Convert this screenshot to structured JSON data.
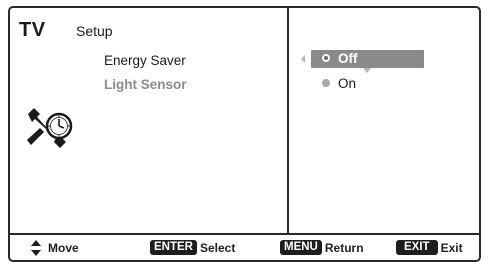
{
  "header": {
    "brand": "TV",
    "section": "Setup"
  },
  "menu": {
    "items": [
      {
        "label": "Energy Saver",
        "state": "active"
      },
      {
        "label": "Light Sensor",
        "state": "disabled"
      }
    ]
  },
  "options": {
    "items": [
      {
        "label": "Off",
        "selected": true
      },
      {
        "label": "On",
        "selected": false
      }
    ]
  },
  "icons": {
    "tools": "wrench-clock-icon",
    "up_down": "up-down-arrows-icon",
    "left_arrow": "left-arrow-icon",
    "down_arrow": "down-arrow-icon"
  },
  "footer": {
    "move_label": "Move",
    "enter_key": "ENTER",
    "enter_label": "Select",
    "menu_key": "MENU",
    "menu_label": "Return",
    "exit_key": "EXIT",
    "exit_label": "Exit"
  },
  "colors": {
    "frame": "#2a2a2a",
    "selected_bg": "#8a8a8a",
    "disabled_text": "#8c8c8c",
    "keycap_bg": "#1e1e1e"
  }
}
